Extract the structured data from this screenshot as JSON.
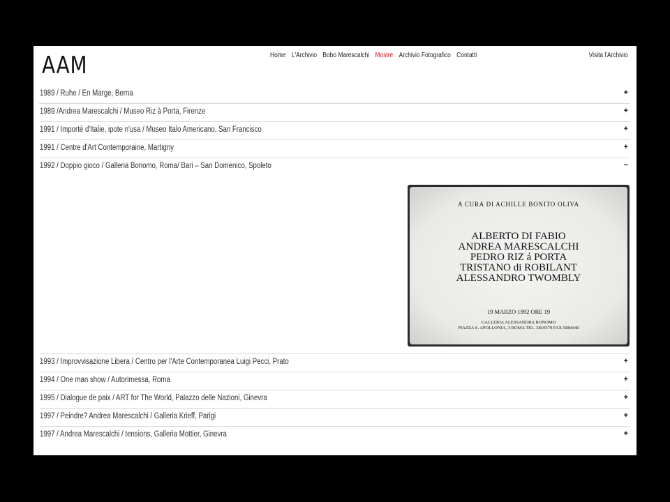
{
  "header": {
    "logo": "AAM",
    "nav": [
      {
        "label": "Home",
        "active": false
      },
      {
        "label": "L'Archivio",
        "active": false
      },
      {
        "label": "Bobo Marescalchi",
        "active": false
      },
      {
        "label": "Mostre",
        "active": true
      },
      {
        "label": "Archivio Fotografico",
        "active": false
      },
      {
        "label": "Contatti",
        "active": false
      }
    ],
    "visit_label": "Visita l'Archivio"
  },
  "accordion": {
    "before": [
      {
        "label": "1989 / Ruhe / En Marge, Berna",
        "toggle": "+"
      },
      {
        "label": "1989 /Andrea Marescalchi / Museo Riz à Porta, Firenze",
        "toggle": "+"
      },
      {
        "label": "1991 / Importè d'Italie, ipote n'usa / Museo Italo Americano, San Francisco",
        "toggle": "+"
      },
      {
        "label": "1991 / Centre d'Art Contemporaine, Martigny",
        "toggle": "+"
      }
    ],
    "open": {
      "label": "1992 / Doppio gioco / Galleria Bonomo, Roma/ Bari – San Domenico, Spoleto",
      "toggle": "−",
      "card": {
        "curator": "A CURA DI ACHILLE BONITO OLIVA",
        "artists": [
          "ALBERTO DI FABIO",
          "ANDREA MARESCALCHI",
          "PEDRO RIZ á PORTA",
          "TRISTANO di ROBILANT",
          "ALESSANDRO TWOMBLY"
        ],
        "date": "19 MARZO 1992 ORE 19",
        "gallery_line1": "GALLERIA ALESSANDRA BONOMO",
        "gallery_line2": "PIAZZA S. APOLLONIA, 3 ROMA TEL. 5810579 FAX 5884440"
      }
    },
    "after": [
      {
        "label": "1993 / Improvvisazione Libera / Centro per l'Arte Contemporanea Luigi Pecci, Prato",
        "toggle": "+"
      },
      {
        "label": "1994 / One man show / Autorimessa, Roma",
        "toggle": "+"
      },
      {
        "label": "1995 / Dialogue de paix / ART for The World, Palazzo delle Nazioni, Ginevra",
        "toggle": "+"
      },
      {
        "label": "1997 / Peindre? Andrea Marescalchi / Galleria Krieff, Parigi",
        "toggle": "+"
      },
      {
        "label": "1997 / Andrea Marescalchi / tensions, Galleria Mottier, Ginevra",
        "toggle": "+"
      }
    ]
  },
  "colors": {
    "accent": "#e30d17",
    "page_bg": "#ffffff",
    "frame_bg": "#000000"
  }
}
